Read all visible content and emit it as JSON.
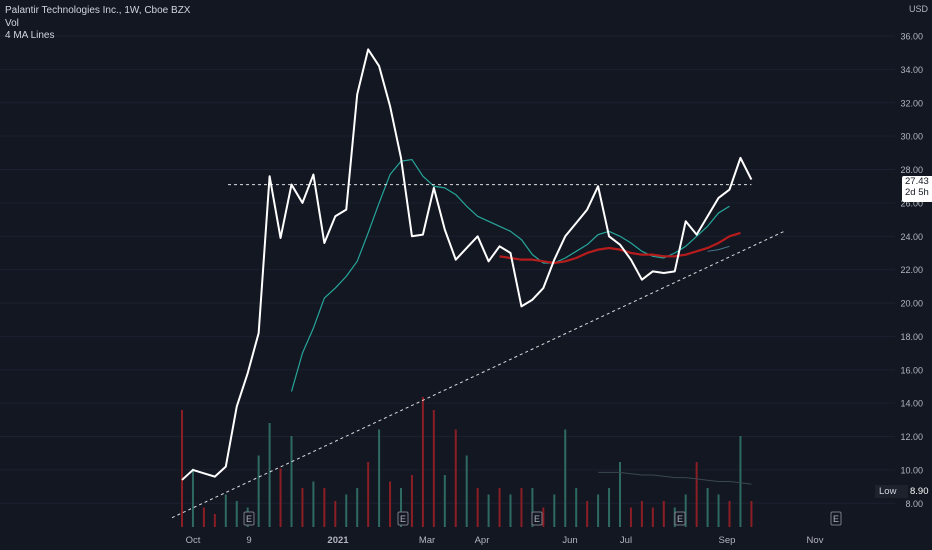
{
  "header": {
    "symbol_line": "Palantir Technologies Inc., 1W, Cboe BZX",
    "vol_label": "Vol",
    "ma_label": "4 MA Lines",
    "currency": "USD"
  },
  "price_tag": {
    "price": "27.43",
    "countdown": "2d 5h"
  },
  "low_tag": {
    "label": "Low",
    "value": "8.90"
  },
  "colors": {
    "background": "#131722",
    "price_line": "#ffffff",
    "ma_fast": "#26a69a",
    "ma_slow": "#b71c1c",
    "vol_up": "#2e6a62",
    "vol_down": "#8b1e24",
    "trendline": "#ffffff"
  },
  "chart_data": {
    "type": "line",
    "x_axis_labels": [
      "Oct",
      "9",
      "2021",
      "Mar",
      "Apr",
      "Jun",
      "Jul",
      "Sep",
      "Nov"
    ],
    "y_ticks": [
      8,
      10,
      12,
      14,
      16,
      18,
      20,
      22,
      24,
      26,
      28,
      30,
      32,
      34,
      36
    ],
    "y_tick_labels": [
      "8.00",
      "10.00",
      "12.00",
      "14.00",
      "16.00",
      "18.00",
      "20.00",
      "22.00",
      "24.00",
      "26.00",
      "28.00",
      "30.00",
      "32.00",
      "34.00",
      "36.00"
    ],
    "ylim": [
      7.0,
      37.8
    ],
    "num_weeks": 76,
    "price_series": [
      9.4,
      10.0,
      9.8,
      9.6,
      10.2,
      13.8,
      15.8,
      18.2,
      27.6,
      23.9,
      27.1,
      26.0,
      27.7,
      23.6,
      25.2,
      25.6,
      32.5,
      35.2,
      34.2,
      31.8,
      28.7,
      24.0,
      24.1,
      26.9,
      24.4,
      22.6,
      23.3,
      24.0,
      22.5,
      23.4,
      23.0,
      19.8,
      20.2,
      20.9,
      22.6,
      24.0,
      24.8,
      25.6,
      27.0,
      24.0,
      23.5,
      22.6,
      21.4,
      21.9,
      21.8,
      21.9,
      24.9,
      24.1,
      25.2,
      26.3,
      26.8,
      28.7,
      27.4
    ],
    "ma_fast": {
      "start_index": 10,
      "values": [
        14.7,
        17.0,
        18.5,
        20.3,
        20.9,
        21.6,
        22.5,
        24.2,
        26.0,
        27.7,
        28.5,
        28.6,
        27.6,
        27.0,
        26.9,
        26.5,
        25.8,
        25.2,
        24.9,
        24.6,
        24.3,
        23.8,
        22.9,
        22.4,
        22.4,
        22.7,
        23.1,
        23.5,
        24.1,
        24.3,
        24.0,
        23.6,
        23.1,
        22.8,
        22.7,
        23.0,
        23.4,
        24.0,
        24.6,
        25.4,
        25.8
      ]
    },
    "ma_slow": {
      "start_index": 29,
      "values": [
        22.8,
        22.7,
        22.6,
        22.6,
        22.5,
        22.4,
        22.5,
        22.7,
        23.0,
        23.2,
        23.3,
        23.2,
        23.0,
        22.9,
        22.9,
        22.8,
        22.8,
        22.9,
        23.1,
        23.3,
        23.6,
        24.0,
        24.2
      ]
    },
    "ma_extra": {
      "start_index": 48,
      "values": [
        23.1,
        23.2,
        23.4
      ]
    },
    "resistance_level": 27.1,
    "trendline": {
      "from": [
        0,
        7.2
      ],
      "to": [
        55,
        24.3
      ]
    },
    "volume_bars": [
      {
        "v": 0.9,
        "up": false
      },
      {
        "v": 0.45,
        "up": true
      },
      {
        "v": 0.15,
        "up": false
      },
      {
        "v": 0.1,
        "up": false
      },
      {
        "v": 0.25,
        "up": true
      },
      {
        "v": 0.2,
        "up": true
      },
      {
        "v": 0.15,
        "up": true
      },
      {
        "v": 0.55,
        "up": true
      },
      {
        "v": 0.8,
        "up": true
      },
      {
        "v": 0.45,
        "up": false
      },
      {
        "v": 0.7,
        "up": true
      },
      {
        "v": 0.3,
        "up": false
      },
      {
        "v": 0.35,
        "up": true
      },
      {
        "v": 0.3,
        "up": false
      },
      {
        "v": 0.2,
        "up": false
      },
      {
        "v": 0.25,
        "up": true
      },
      {
        "v": 0.3,
        "up": true
      },
      {
        "v": 0.5,
        "up": false
      },
      {
        "v": 0.75,
        "up": true
      },
      {
        "v": 0.35,
        "up": false
      },
      {
        "v": 0.3,
        "up": true
      },
      {
        "v": 0.4,
        "up": false
      },
      {
        "v": 1.0,
        "up": false
      },
      {
        "v": 0.9,
        "up": false
      },
      {
        "v": 0.4,
        "up": true
      },
      {
        "v": 0.75,
        "up": false
      },
      {
        "v": 0.55,
        "up": true
      },
      {
        "v": 0.3,
        "up": false
      },
      {
        "v": 0.25,
        "up": true
      },
      {
        "v": 0.3,
        "up": false
      },
      {
        "v": 0.25,
        "up": true
      },
      {
        "v": 0.3,
        "up": false
      },
      {
        "v": 0.3,
        "up": true
      },
      {
        "v": 0.15,
        "up": false
      },
      {
        "v": 0.25,
        "up": true
      },
      {
        "v": 0.75,
        "up": true
      },
      {
        "v": 0.3,
        "up": true
      },
      {
        "v": 0.2,
        "up": false
      },
      {
        "v": 0.25,
        "up": true
      },
      {
        "v": 0.3,
        "up": true
      },
      {
        "v": 0.5,
        "up": true
      },
      {
        "v": 0.15,
        "up": false
      },
      {
        "v": 0.2,
        "up": false
      },
      {
        "v": 0.15,
        "up": false
      },
      {
        "v": 0.2,
        "up": false
      },
      {
        "v": 0.15,
        "up": true
      },
      {
        "v": 0.25,
        "up": true
      },
      {
        "v": 0.5,
        "up": false
      },
      {
        "v": 0.3,
        "up": true
      },
      {
        "v": 0.25,
        "up": true
      },
      {
        "v": 0.2,
        "up": false
      },
      {
        "v": 0.7,
        "up": true
      },
      {
        "v": 0.2,
        "up": false
      }
    ],
    "volume_ma": {
      "start_index": 38,
      "values": [
        0.42,
        0.42,
        0.42,
        0.41,
        0.4,
        0.4,
        0.39,
        0.38,
        0.38,
        0.37,
        0.36,
        0.35,
        0.35,
        0.34,
        0.33
      ]
    },
    "earnings_markers": [
      {
        "label": "E",
        "index": 9
      },
      {
        "label": "E",
        "index": 29
      },
      {
        "label": "E",
        "index": 47
      },
      {
        "label": "E",
        "index": 66
      },
      {
        "label": "E",
        "index": 85
      }
    ]
  }
}
